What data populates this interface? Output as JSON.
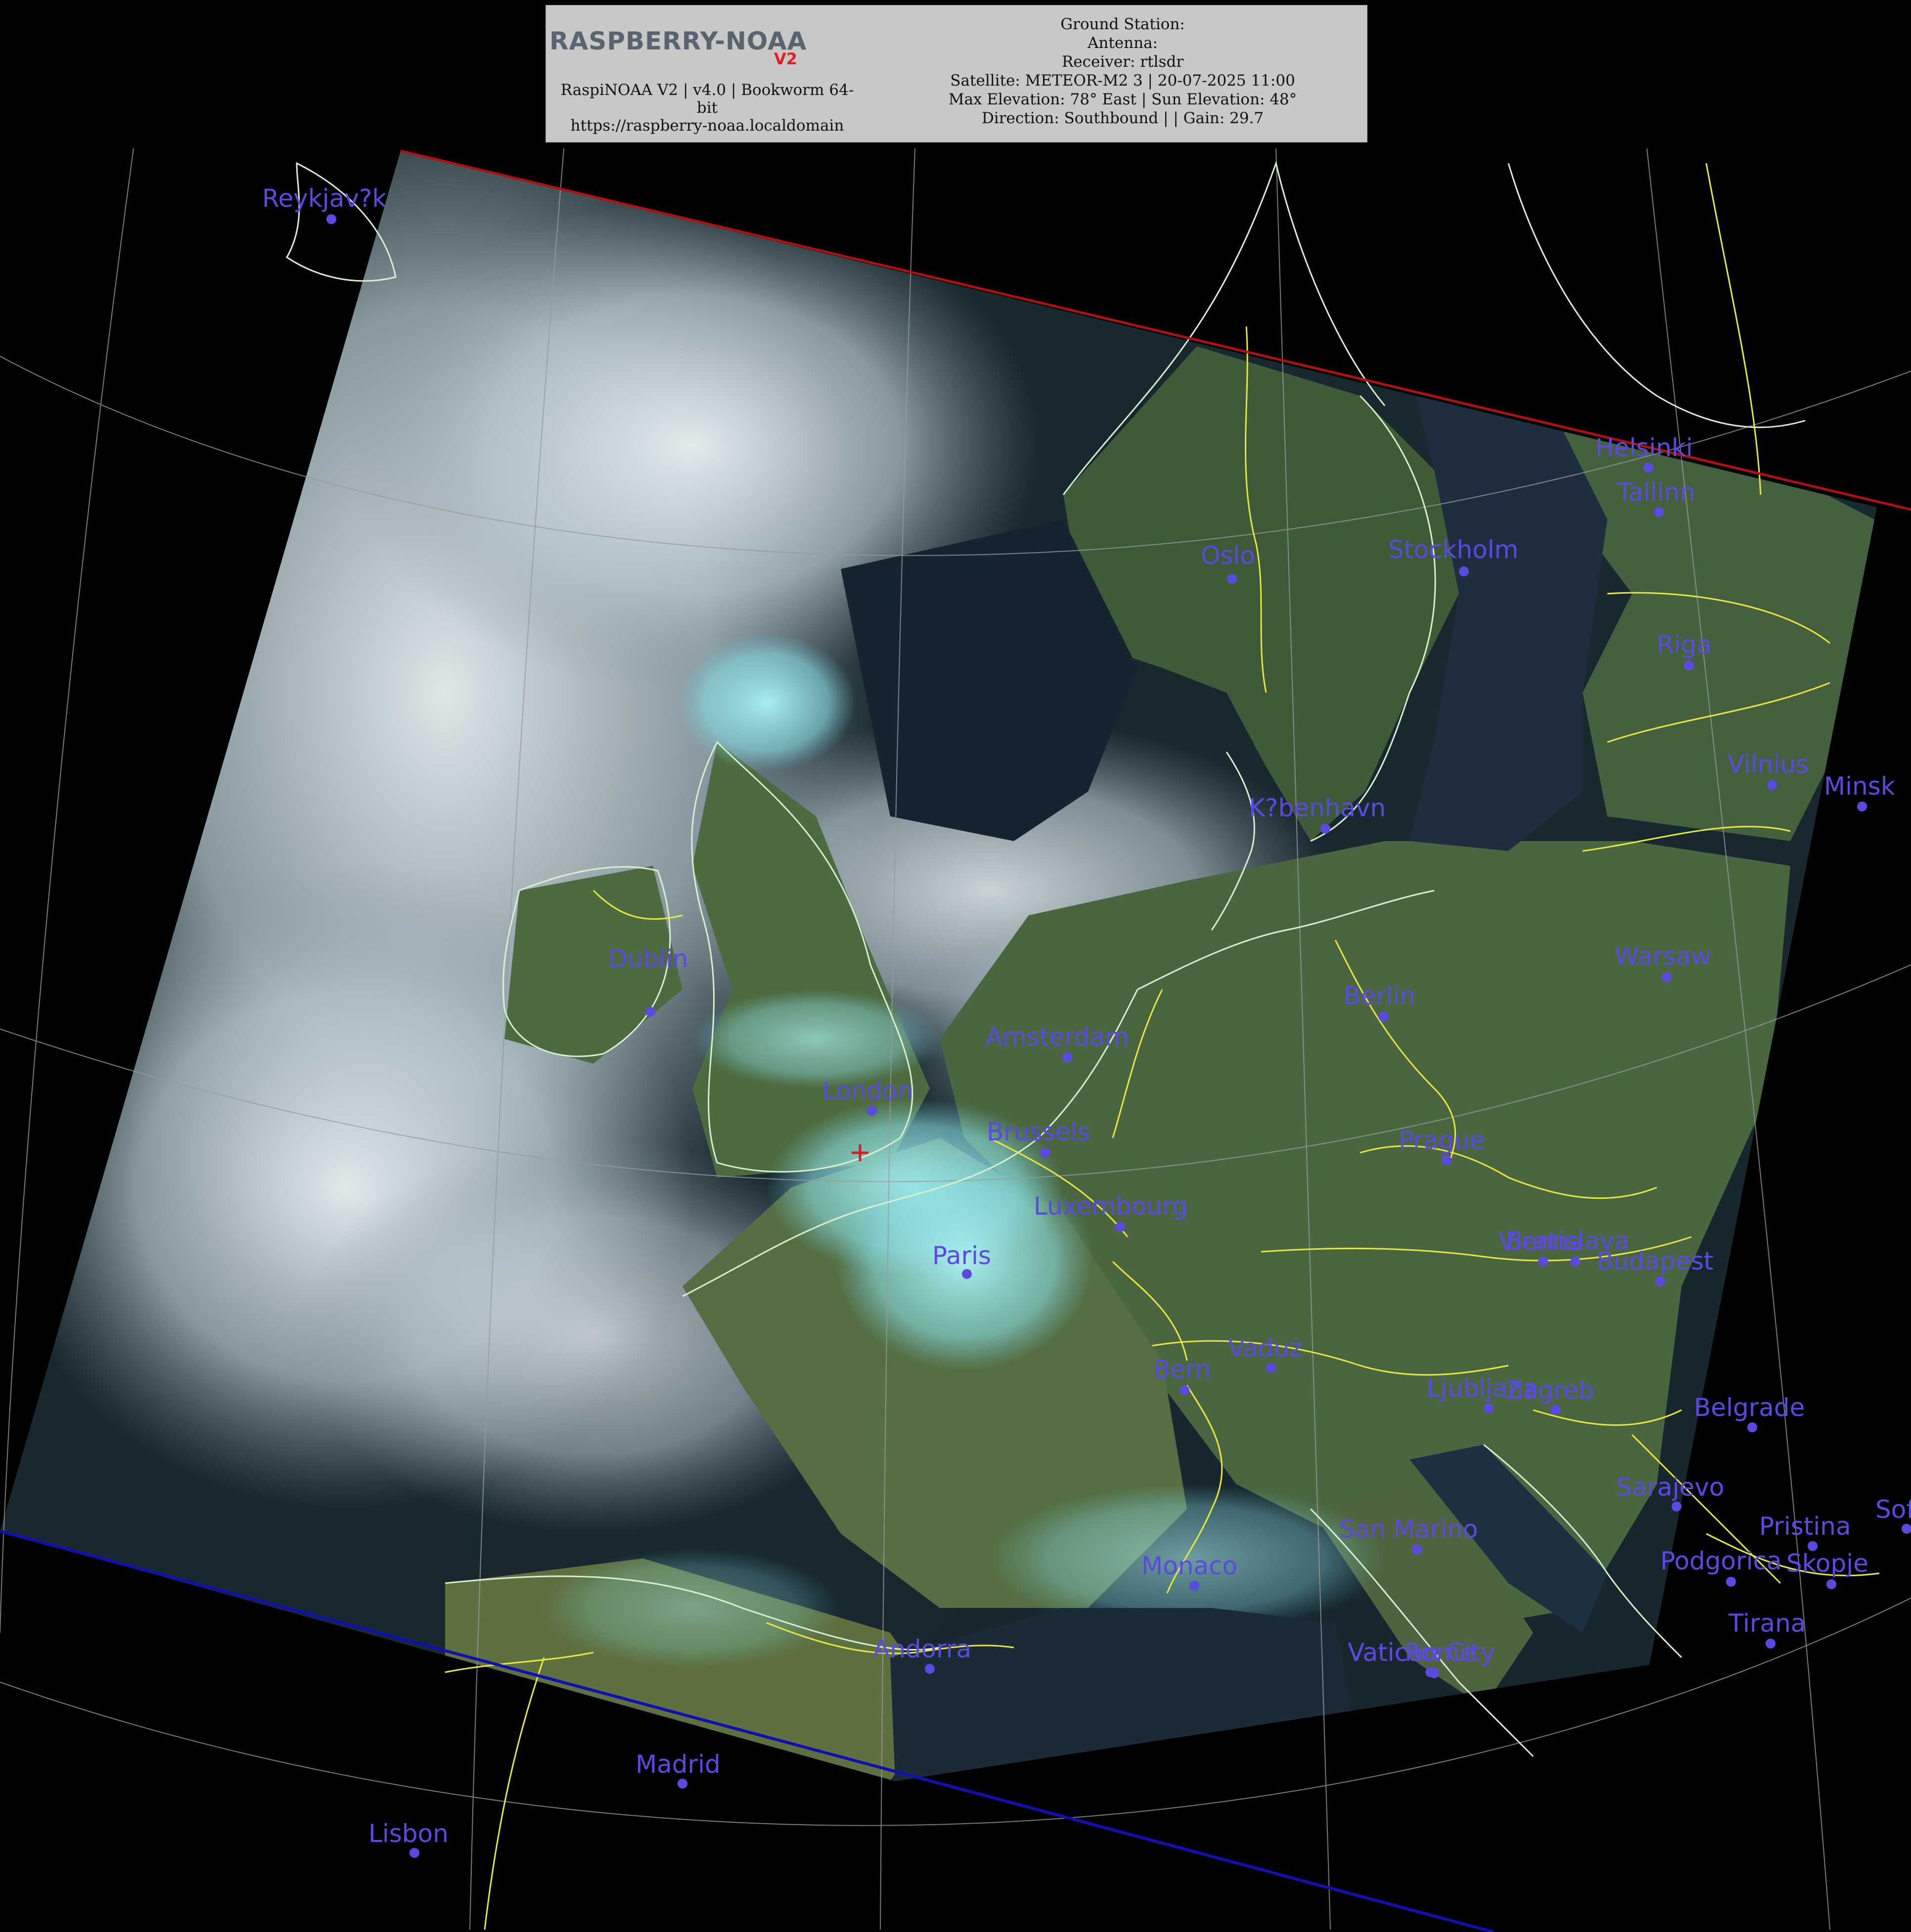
{
  "header": {
    "logo_text": "RASPBERRY-NOAA",
    "logo_version": "V2",
    "left_lines": [
      "RaspiNOAA V2 | v4.0 | Bookworm 64-",
      "bit",
      "https://raspberry-noaa.localdomain"
    ],
    "right_lines": [
      "Ground Station:",
      "Antenna:",
      "Receiver: rtlsdr",
      "Satellite: METEOR-M2 3 | 20-07-2025 11:00",
      "Max Elevation: 78° East | Sun Elevation: 48°",
      "Direction: Southbound | | Gain: 29.7"
    ]
  },
  "colors": {
    "city_marker": "#5a4ae0",
    "coastline": "#d8f0d0",
    "border": "#e8e840",
    "grid": "#9a9a9a",
    "ground_station": "#d02020",
    "swath_top_edge": "#b01010",
    "swath_bottom_edge": "#1010b0"
  },
  "cities": [
    "Reykjav?k",
    "Helsinki",
    "Tallinn",
    "Oslo",
    "Stockholm",
    "Riga",
    "Vilnius",
    "Minsk",
    "K?benhavn",
    "Dublin",
    "Warsaw",
    "Berlin",
    "Amsterdam",
    "London",
    "Brussels",
    "Prague",
    "Luxembourg",
    "Bratislava",
    "Vienna",
    "Budapest",
    "Paris",
    "Vaduz",
    "Bern",
    "Ljubljana",
    "Zagreb",
    "Belgrade",
    "Sarajevo",
    "Sofia",
    "Pristina",
    "San Marino",
    "Podgorica",
    "Skopje",
    "Monaco",
    "Tirana",
    "Andorra",
    "Vatican City",
    "Rome",
    "Madrid",
    "Lisbon"
  ]
}
